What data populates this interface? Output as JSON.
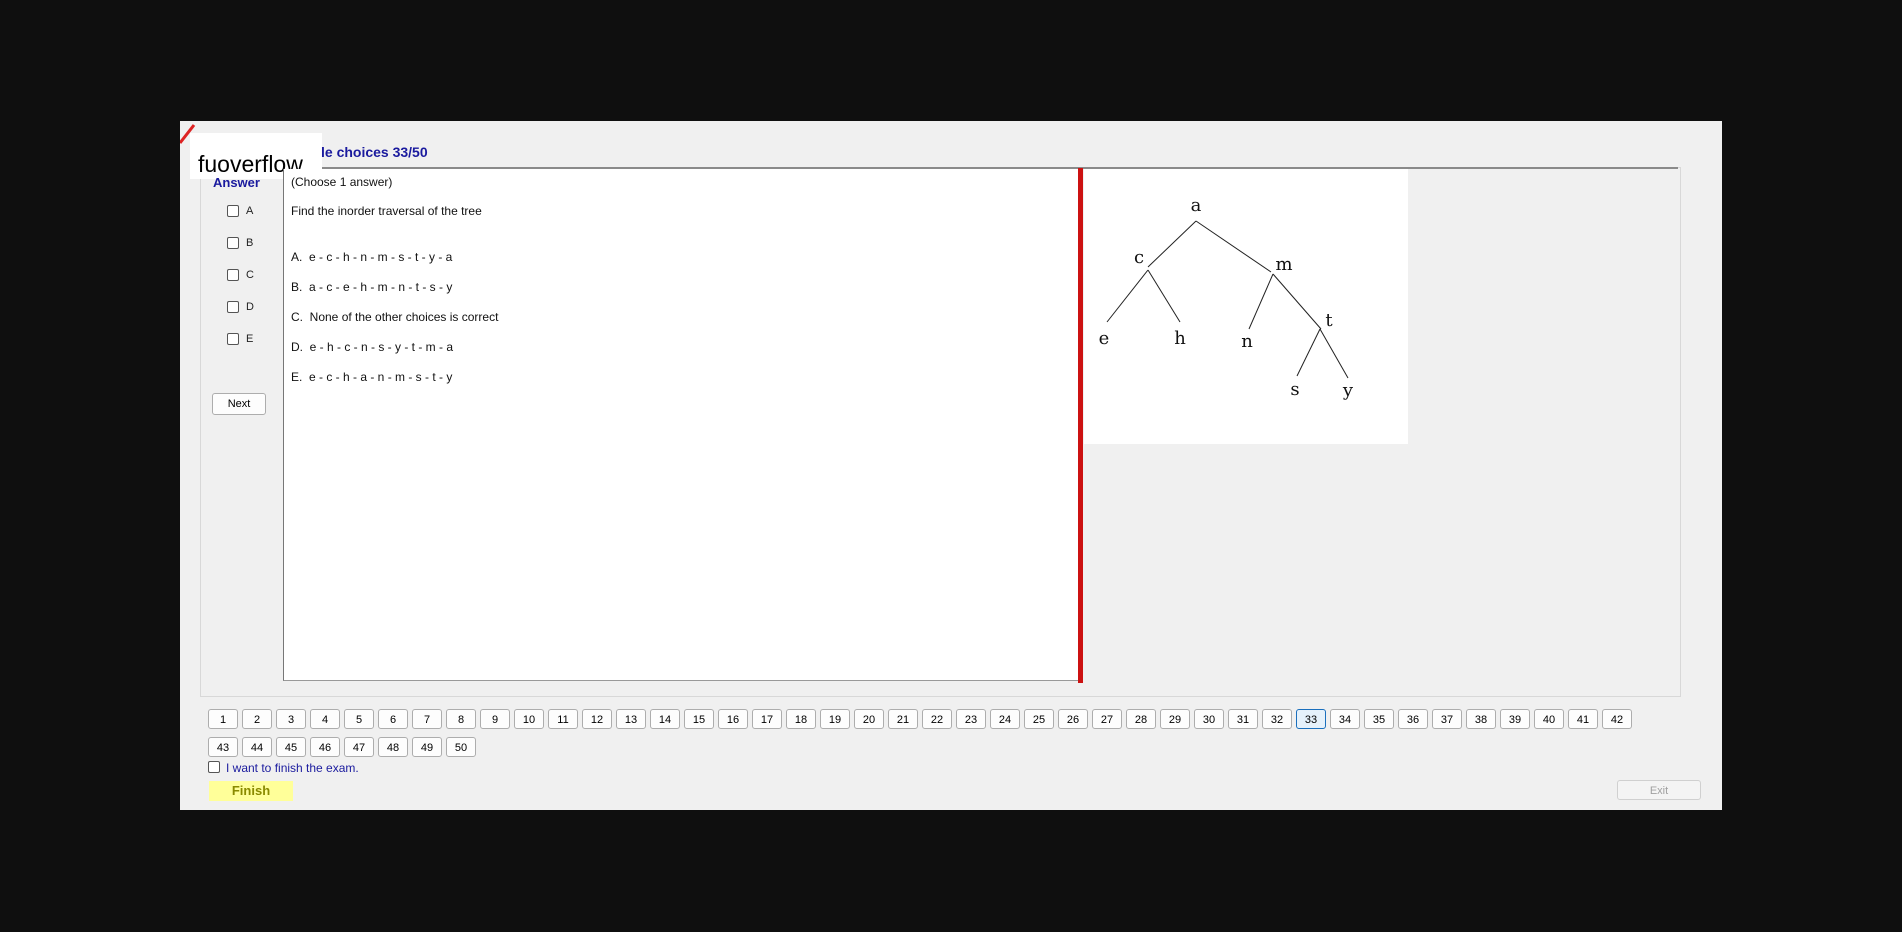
{
  "watermark": "fuoverflow",
  "title": "le choices 33/50",
  "answer_panel": {
    "heading": "Answer",
    "options": [
      "A",
      "B",
      "C",
      "D",
      "E"
    ],
    "next_label": "Next"
  },
  "question": {
    "instruction": "(Choose 1 answer)",
    "text": "Find the inorder traversal of the tree",
    "choices": [
      "A.  e - c - h - n - m - s - t - y - a",
      "B.  a - c - e - h - m - n - t - s - y",
      "C.  None of the other choices is correct",
      "D.  e - h - c - n - s - y - t - m - a",
      "E.  e - c - h - a - n - m - s - t - y"
    ]
  },
  "tree": {
    "nodes": [
      "a",
      "c",
      "m",
      "e",
      "h",
      "n",
      "t",
      "s",
      "y"
    ]
  },
  "navigation": {
    "pages": [
      "1",
      "2",
      "3",
      "4",
      "5",
      "6",
      "7",
      "8",
      "9",
      "10",
      "11",
      "12",
      "13",
      "14",
      "15",
      "16",
      "17",
      "18",
      "19",
      "20",
      "21",
      "22",
      "23",
      "24",
      "25",
      "26",
      "27",
      "28",
      "29",
      "30",
      "31",
      "32",
      "33",
      "34",
      "35",
      "36",
      "37",
      "38",
      "39",
      "40",
      "41",
      "42",
      "43",
      "44",
      "45",
      "46",
      "47",
      "48",
      "49",
      "50"
    ],
    "current": "33"
  },
  "finish": {
    "checkbox_label": "I want to finish the exam.",
    "finish_label": "Finish",
    "exit_label": "Exit"
  },
  "colors": {
    "accent": "#1a1a9e",
    "divider": "#cc1111",
    "finish_bg": "#ffff99"
  }
}
